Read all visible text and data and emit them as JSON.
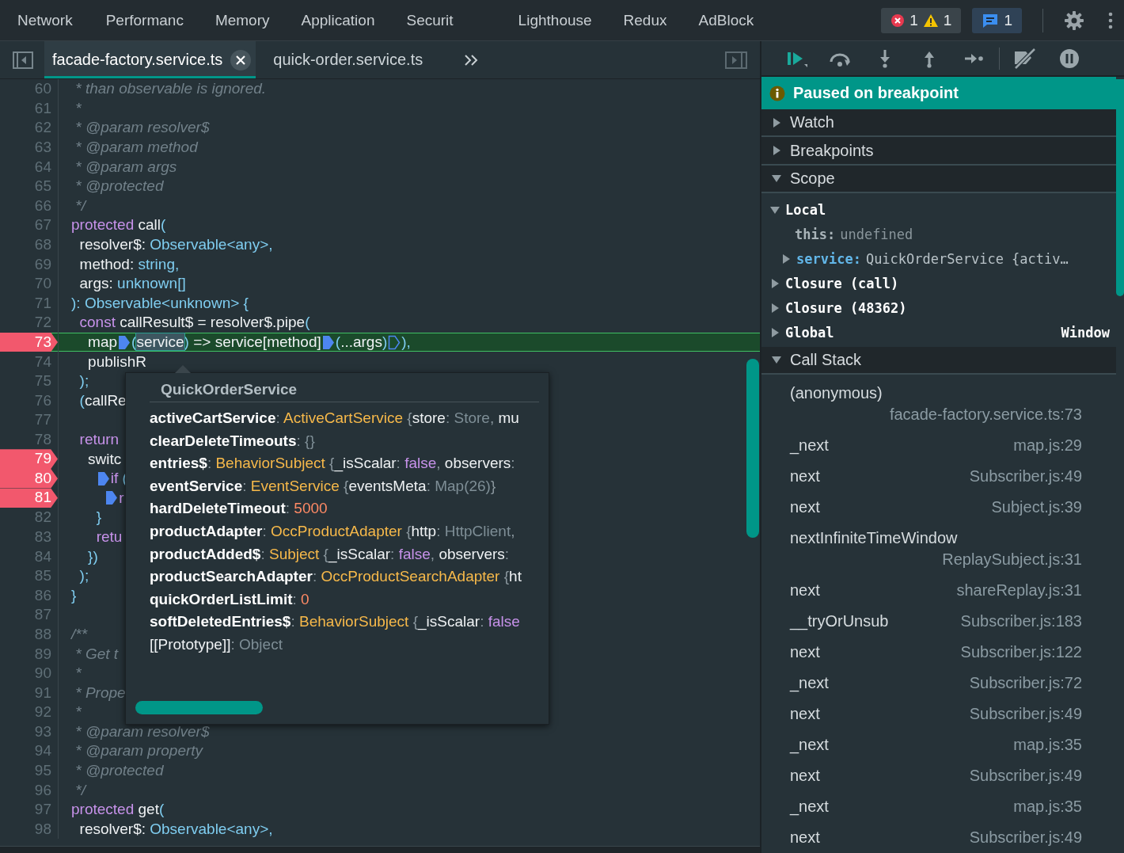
{
  "panel_tabs": [
    {
      "label": "Network",
      "selected": false
    },
    {
      "label": "Performanc",
      "selected": false
    },
    {
      "label": "Memory",
      "selected": false
    },
    {
      "label": "Application",
      "selected": false
    },
    {
      "label": "Securit",
      "selected": false
    },
    {
      "label": "Lighthouse",
      "selected": false
    },
    {
      "label": "Redux",
      "selected": false
    },
    {
      "label": "AdBlock",
      "selected": false
    }
  ],
  "issue_counters": [
    {
      "kind": "error",
      "count": "1"
    },
    {
      "kind": "warning",
      "count": "1"
    },
    {
      "kind": "message",
      "count": "1"
    }
  ],
  "file_tabs": [
    {
      "label": "facade-factory.service.ts",
      "selected": true
    },
    {
      "label": "quick-order.service.ts",
      "selected": false
    }
  ],
  "code_lines": [
    {
      "number": "60",
      "breakpoint": false,
      "paused": false,
      "tokens": [
        {
          "kind": "comment",
          "text": " * than observable is ignored."
        }
      ]
    },
    {
      "number": "61",
      "breakpoint": false,
      "paused": false,
      "tokens": [
        {
          "kind": "comment",
          "text": " *"
        }
      ]
    },
    {
      "number": "62",
      "breakpoint": false,
      "paused": false,
      "tokens": [
        {
          "kind": "comment",
          "text": " * @param resolver$"
        }
      ]
    },
    {
      "number": "63",
      "breakpoint": false,
      "paused": false,
      "tokens": [
        {
          "kind": "comment",
          "text": " * @param method"
        }
      ]
    },
    {
      "number": "64",
      "breakpoint": false,
      "paused": false,
      "tokens": [
        {
          "kind": "comment",
          "text": " * @param args"
        }
      ]
    },
    {
      "number": "65",
      "breakpoint": false,
      "paused": false,
      "tokens": [
        {
          "kind": "comment",
          "text": " * @protected"
        }
      ]
    },
    {
      "number": "66",
      "breakpoint": false,
      "paused": false,
      "tokens": [
        {
          "kind": "comment",
          "text": " */"
        }
      ]
    },
    {
      "number": "67",
      "breakpoint": false,
      "paused": false,
      "tokens": [
        {
          "kind": "keyword",
          "text": "protected"
        },
        {
          "kind": "plain",
          "text": " call"
        },
        {
          "kind": "type",
          "text": "("
        }
      ]
    },
    {
      "number": "68",
      "breakpoint": false,
      "paused": false,
      "tokens": [
        {
          "kind": "plain",
          "text": "  resolver$: "
        },
        {
          "kind": "type",
          "text": "Observable<any>,"
        }
      ]
    },
    {
      "number": "69",
      "breakpoint": false,
      "paused": false,
      "tokens": [
        {
          "kind": "plain",
          "text": "  method: "
        },
        {
          "kind": "type",
          "text": "string,"
        }
      ]
    },
    {
      "number": "70",
      "breakpoint": false,
      "paused": false,
      "tokens": [
        {
          "kind": "plain",
          "text": "  args: "
        },
        {
          "kind": "type",
          "text": "unknown[]"
        }
      ]
    },
    {
      "number": "71",
      "breakpoint": false,
      "paused": false,
      "tokens": [
        {
          "kind": "type",
          "text": "): Observable<unknown> {"
        }
      ]
    },
    {
      "number": "72",
      "breakpoint": false,
      "paused": false,
      "tokens": [
        {
          "kind": "keyword",
          "text": "  const"
        },
        {
          "kind": "plain",
          "text": " callResult$ = resolver$.pipe"
        },
        {
          "kind": "type",
          "text": "("
        }
      ]
    },
    {
      "number": "73",
      "breakpoint": true,
      "paused": true,
      "tokens": [
        {
          "kind": "plain",
          "text": "    map"
        },
        {
          "kind": "type",
          "text": "(",
          "inline_breakpoint": true,
          "active": true
        },
        {
          "kind": "hover",
          "text": "service"
        },
        {
          "kind": "type",
          "text": ")"
        },
        {
          "kind": "plain",
          "text": " => service[method]"
        },
        {
          "kind": "type",
          "text": "(",
          "inline_breakpoint": true,
          "active": true
        },
        {
          "kind": "plain",
          "text": "...args"
        },
        {
          "kind": "type",
          "text": ")"
        },
        {
          "kind": "type",
          "text": "),",
          "inline_breakpoint": true,
          "active": false
        }
      ]
    },
    {
      "number": "74",
      "breakpoint": false,
      "paused": false,
      "tokens": [
        {
          "kind": "plain",
          "text": "    publishR"
        }
      ]
    },
    {
      "number": "75",
      "breakpoint": false,
      "paused": false,
      "tokens": [
        {
          "kind": "type",
          "text": "  );"
        }
      ]
    },
    {
      "number": "76",
      "breakpoint": false,
      "paused": false,
      "tokens": [
        {
          "kind": "type",
          "text": "  ("
        },
        {
          "kind": "plain",
          "text": "callRe"
        }
      ]
    },
    {
      "number": "77",
      "breakpoint": false,
      "paused": false
    },
    {
      "number": "78",
      "breakpoint": false,
      "paused": false,
      "tokens": [
        {
          "kind": "keyword",
          "text": "  return"
        }
      ]
    },
    {
      "number": "79",
      "breakpoint": true,
      "paused": false,
      "tokens": [
        {
          "kind": "plain",
          "text": "    switc"
        }
      ]
    },
    {
      "number": "80",
      "breakpoint": true,
      "paused": false,
      "tokens": [
        {
          "kind": "keyword",
          "text": "      if",
          "inline_breakpoint": true,
          "active": true
        },
        {
          "kind": "type",
          "text": " ("
        }
      ]
    },
    {
      "number": "81",
      "breakpoint": true,
      "paused": false,
      "tokens": [
        {
          "kind": "keyword",
          "text": "        r",
          "inline_breakpoint": true,
          "active": true
        }
      ]
    },
    {
      "number": "82",
      "breakpoint": false,
      "paused": false,
      "tokens": [
        {
          "kind": "type",
          "text": "      }"
        }
      ]
    },
    {
      "number": "83",
      "breakpoint": false,
      "paused": false,
      "tokens": [
        {
          "kind": "keyword",
          "text": "      retu"
        }
      ]
    },
    {
      "number": "84",
      "breakpoint": false,
      "paused": false,
      "tokens": [
        {
          "kind": "type",
          "text": "    })"
        }
      ]
    },
    {
      "number": "85",
      "breakpoint": false,
      "paused": false,
      "tokens": [
        {
          "kind": "type",
          "text": "  );"
        }
      ]
    },
    {
      "number": "86",
      "breakpoint": false,
      "paused": false,
      "tokens": [
        {
          "kind": "type",
          "text": "}"
        }
      ]
    },
    {
      "number": "87",
      "breakpoint": false,
      "paused": false
    },
    {
      "number": "88",
      "breakpoint": false,
      "paused": false,
      "tokens": [
        {
          "kind": "comment",
          "text": "/**"
        }
      ]
    },
    {
      "number": "89",
      "breakpoint": false,
      "paused": false,
      "tokens": [
        {
          "kind": "comment",
          "text": " * Get t"
        }
      ]
    },
    {
      "number": "90",
      "breakpoint": false,
      "paused": false,
      "tokens": [
        {
          "kind": "comment",
          "text": " *"
        }
      ]
    },
    {
      "number": "91",
      "breakpoint": false,
      "paused": false,
      "tokens": [
        {
          "kind": "comment",
          "text": " * Prope"
        }
      ]
    },
    {
      "number": "92",
      "breakpoint": false,
      "paused": false,
      "tokens": [
        {
          "kind": "comment",
          "text": " *"
        }
      ]
    },
    {
      "number": "93",
      "breakpoint": false,
      "paused": false,
      "tokens": [
        {
          "kind": "comment",
          "text": " * @param resolver$"
        }
      ]
    },
    {
      "number": "94",
      "breakpoint": false,
      "paused": false,
      "tokens": [
        {
          "kind": "comment",
          "text": " * @param property"
        }
      ]
    },
    {
      "number": "95",
      "breakpoint": false,
      "paused": false,
      "tokens": [
        {
          "kind": "comment",
          "text": " * @protected"
        }
      ]
    },
    {
      "number": "96",
      "breakpoint": false,
      "paused": false,
      "tokens": [
        {
          "kind": "comment",
          "text": " */"
        }
      ]
    },
    {
      "number": "97",
      "breakpoint": false,
      "paused": false,
      "tokens": [
        {
          "kind": "keyword",
          "text": "protected"
        },
        {
          "kind": "plain",
          "text": " get"
        },
        {
          "kind": "type",
          "text": "("
        }
      ]
    },
    {
      "number": "98",
      "breakpoint": false,
      "paused": false,
      "tokens": [
        {
          "kind": "plain",
          "text": "  resolver$: "
        },
        {
          "kind": "type",
          "text": "Observable<any>,"
        }
      ]
    }
  ],
  "hover_popup": {
    "title": "QuickOrderService",
    "rows": [
      {
        "parts": [
          {
            "kind": "name",
            "text": "activeCartService"
          },
          {
            "kind": "punct",
            "text": ": "
          },
          {
            "kind": "class",
            "text": "ActiveCartService"
          },
          {
            "kind": "punct",
            "text": " {"
          },
          {
            "kind": "key",
            "text": "store"
          },
          {
            "kind": "punct",
            "text": ": "
          },
          {
            "kind": "dim",
            "text": "Store"
          },
          {
            "kind": "punct",
            "text": ", "
          },
          {
            "kind": "key",
            "text": "mu"
          }
        ]
      },
      {
        "parts": [
          {
            "kind": "name",
            "text": "clearDeleteTimeouts"
          },
          {
            "kind": "punct",
            "text": ": "
          },
          {
            "kind": "dim",
            "text": "{}"
          }
        ]
      },
      {
        "parts": [
          {
            "kind": "name",
            "text": "entries$"
          },
          {
            "kind": "punct",
            "text": ": "
          },
          {
            "kind": "class",
            "text": "BehaviorSubject"
          },
          {
            "kind": "punct",
            "text": " {"
          },
          {
            "kind": "key",
            "text": "_isScalar"
          },
          {
            "kind": "punct",
            "text": ": "
          },
          {
            "kind": "bool",
            "text": "false"
          },
          {
            "kind": "punct",
            "text": ", "
          },
          {
            "kind": "key",
            "text": "observers"
          },
          {
            "kind": "punct",
            "text": ":"
          }
        ]
      },
      {
        "parts": [
          {
            "kind": "name",
            "text": "eventService"
          },
          {
            "kind": "punct",
            "text": ": "
          },
          {
            "kind": "class",
            "text": "EventService"
          },
          {
            "kind": "punct",
            "text": " {"
          },
          {
            "kind": "key",
            "text": "eventsMeta"
          },
          {
            "kind": "punct",
            "text": ": "
          },
          {
            "kind": "dim",
            "text": "Map(26)"
          },
          {
            "kind": "punct",
            "text": "}"
          }
        ]
      },
      {
        "parts": [
          {
            "kind": "name",
            "text": "hardDeleteTimeout"
          },
          {
            "kind": "punct",
            "text": ": "
          },
          {
            "kind": "number",
            "text": "5000"
          }
        ]
      },
      {
        "parts": [
          {
            "kind": "name",
            "text": "productAdapter"
          },
          {
            "kind": "punct",
            "text": ": "
          },
          {
            "kind": "class",
            "text": "OccProductAdapter"
          },
          {
            "kind": "punct",
            "text": " {"
          },
          {
            "kind": "key",
            "text": "http"
          },
          {
            "kind": "punct",
            "text": ": "
          },
          {
            "kind": "dim",
            "text": "HttpClient"
          },
          {
            "kind": "punct",
            "text": ","
          }
        ]
      },
      {
        "parts": [
          {
            "kind": "name",
            "text": "productAdded$"
          },
          {
            "kind": "punct",
            "text": ": "
          },
          {
            "kind": "class",
            "text": "Subject"
          },
          {
            "kind": "punct",
            "text": " {"
          },
          {
            "kind": "key",
            "text": "_isScalar"
          },
          {
            "kind": "punct",
            "text": ": "
          },
          {
            "kind": "bool",
            "text": "false"
          },
          {
            "kind": "punct",
            "text": ", "
          },
          {
            "kind": "key",
            "text": "observers"
          },
          {
            "kind": "punct",
            "text": ":"
          }
        ]
      },
      {
        "parts": [
          {
            "kind": "name",
            "text": "productSearchAdapter"
          },
          {
            "kind": "punct",
            "text": ": "
          },
          {
            "kind": "class",
            "text": "OccProductSearchAdapter"
          },
          {
            "kind": "punct",
            "text": " {"
          },
          {
            "kind": "key",
            "text": "ht"
          }
        ]
      },
      {
        "parts": [
          {
            "kind": "name",
            "text": "quickOrderListLimit"
          },
          {
            "kind": "punct",
            "text": ": "
          },
          {
            "kind": "number",
            "text": "0"
          }
        ]
      },
      {
        "parts": [
          {
            "kind": "name",
            "text": "softDeletedEntries$"
          },
          {
            "kind": "punct",
            "text": ": "
          },
          {
            "kind": "class",
            "text": "BehaviorSubject"
          },
          {
            "kind": "punct",
            "text": " {"
          },
          {
            "kind": "key",
            "text": "_isScalar"
          },
          {
            "kind": "punct",
            "text": ": "
          },
          {
            "kind": "bool",
            "text": "false"
          }
        ]
      },
      {
        "parts": [
          {
            "kind": "key",
            "text": "[[Prototype]]"
          },
          {
            "kind": "punct",
            "text": ": "
          },
          {
            "kind": "dim",
            "text": "Object"
          }
        ]
      }
    ]
  },
  "status_banner": {
    "text": "Paused on breakpoint"
  },
  "sections": [
    {
      "kind": "plain",
      "title": "Watch",
      "expanded": false
    },
    {
      "kind": "plain",
      "title": "Breakpoints",
      "expanded": false
    },
    {
      "kind": "scope",
      "title": "Scope",
      "expanded": true,
      "scopes": [
        {
          "label": "Local",
          "expanded": true,
          "children": [
            {
              "kind": "leaf",
              "name": "this:",
              "value": "undefined"
            },
            {
              "kind": "object",
              "name": "service:",
              "value": "QuickOrderService {activ…",
              "expanded": false
            }
          ]
        },
        {
          "label": "Closure (call)",
          "expanded": false
        },
        {
          "label": "Closure (48362)",
          "expanded": false
        },
        {
          "label": "Global",
          "value": "Window",
          "expanded": false
        }
      ]
    },
    {
      "kind": "call_stack",
      "title": "Call Stack",
      "expanded": true,
      "frames": [
        {
          "function": "(anonymous)",
          "location": "facade-factory.service.ts:73"
        },
        {
          "function": "_next",
          "location": "map.js:29"
        },
        {
          "function": "next",
          "location": "Subscriber.js:49"
        },
        {
          "function": "next",
          "location": "Subject.js:39"
        },
        {
          "function": "nextInfiniteTimeWindow",
          "location": "ReplaySubject.js:31"
        },
        {
          "function": "next",
          "location": "shareReplay.js:31"
        },
        {
          "function": "__tryOrUnsub",
          "location": "Subscriber.js:183"
        },
        {
          "function": "next",
          "location": "Subscriber.js:122"
        },
        {
          "function": "_next",
          "location": "Subscriber.js:72"
        },
        {
          "function": "next",
          "location": "Subscriber.js:49"
        },
        {
          "function": "_next",
          "location": "map.js:35"
        },
        {
          "function": "next",
          "location": "Subscriber.js:49"
        },
        {
          "function": "_next",
          "location": "map.js:35"
        },
        {
          "function": "next",
          "location": "Subscriber.js:49"
        }
      ]
    }
  ]
}
